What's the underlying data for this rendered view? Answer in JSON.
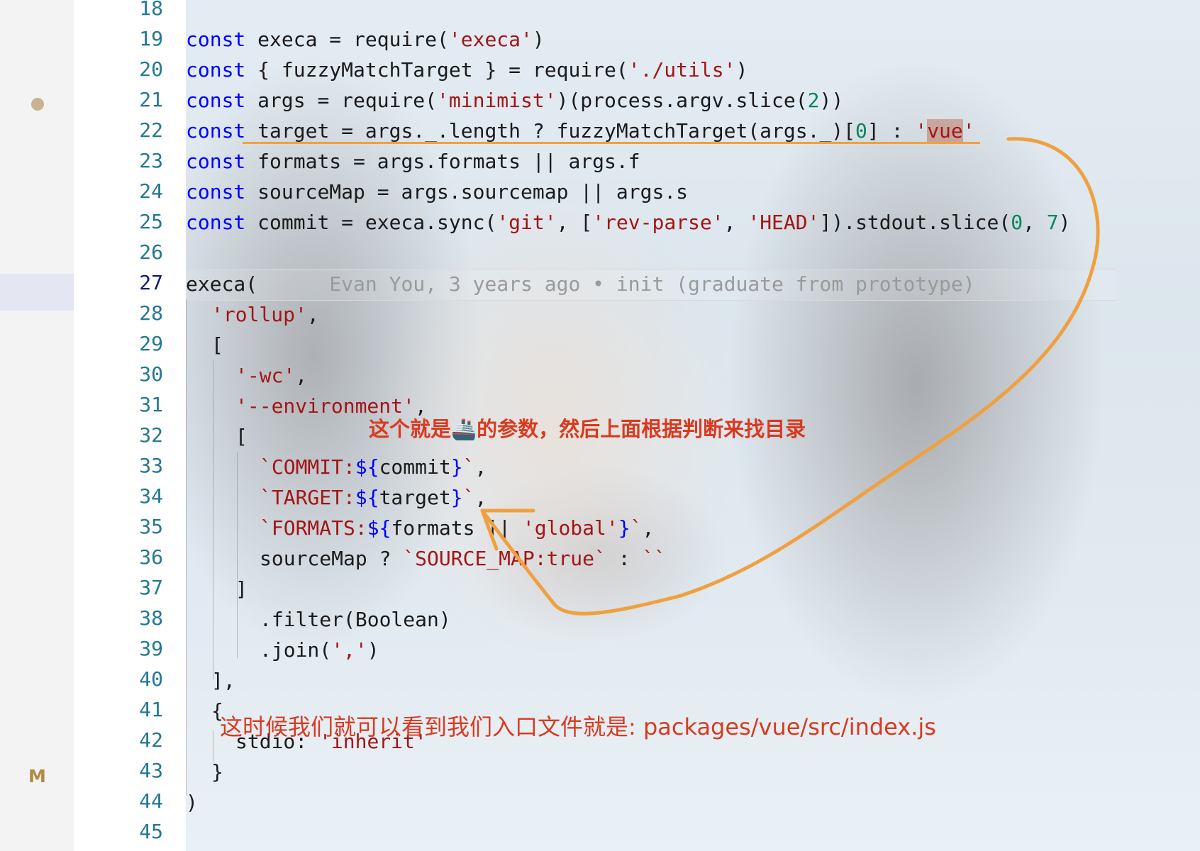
{
  "gutter": {
    "lines": [
      {
        "n": "18"
      },
      {
        "n": "19"
      },
      {
        "n": "20"
      },
      {
        "n": "21"
      },
      {
        "n": "22"
      },
      {
        "n": "23"
      },
      {
        "n": "24"
      },
      {
        "n": "25"
      },
      {
        "n": "26"
      },
      {
        "n": "27"
      },
      {
        "n": "28"
      },
      {
        "n": "29"
      },
      {
        "n": "30"
      },
      {
        "n": "31"
      },
      {
        "n": "32"
      },
      {
        "n": "33"
      },
      {
        "n": "34"
      },
      {
        "n": "35"
      },
      {
        "n": "36"
      },
      {
        "n": "37"
      },
      {
        "n": "38"
      },
      {
        "n": "39"
      },
      {
        "n": "40"
      },
      {
        "n": "41"
      },
      {
        "n": "42"
      },
      {
        "n": "43"
      },
      {
        "n": "44"
      },
      {
        "n": "45"
      }
    ],
    "active_line": "27",
    "git_modified_label": "M"
  },
  "code": {
    "l19": {
      "kw": "const",
      "a": " execa = require(",
      "s": "'execa'",
      "b": ")"
    },
    "l20": {
      "kw": "const",
      "a": " { fuzzyMatchTarget } = require(",
      "s": "'./utils'",
      "b": ")"
    },
    "l21": {
      "kw": "const",
      "a": " args = require(",
      "s": "'minimist'",
      "b": ")(process.argv.slice(",
      "n": "2",
      "c": "))"
    },
    "l22": {
      "kw": "const",
      "a": " target = args._.length ? fuzzyMatchTarget(args._)[",
      "n": "0",
      "b": "] : ",
      "s1": "'",
      "s2": "vue",
      "s3": "'"
    },
    "l23": {
      "kw": "const",
      "a": " formats = args.formats || args.f"
    },
    "l24": {
      "kw": "const",
      "a": " sourceMap = args.sourcemap || args.s"
    },
    "l25": {
      "kw": "const",
      "a": " commit = execa.sync(",
      "s1": "'git'",
      "b": ", [",
      "s2": "'rev-parse'",
      "c": ", ",
      "s3": "'HEAD'",
      "d": "]).stdout.slice(",
      "n1": "0",
      "e": ", ",
      "n2": "7",
      "f": ")"
    },
    "l27": {
      "a": "execa(",
      "blame": "Evan You, 3 years ago • init (graduate from prototype)"
    },
    "l28": {
      "s": "'rollup'",
      "b": ","
    },
    "l29": {
      "a": "["
    },
    "l30": {
      "s": "'-wc'",
      "b": ","
    },
    "l31": {
      "s": "'--environment'",
      "b": ","
    },
    "l32": {
      "a": "["
    },
    "l33": {
      "s1": "`COMMIT:",
      "p1": "${",
      "v": "commit",
      "p2": "}",
      "s2": "`",
      "b": ","
    },
    "l34": {
      "s1": "`TARGET:",
      "p1": "${",
      "v": "target",
      "p2": "}",
      "s2": "`",
      "b": ","
    },
    "l35": {
      "s1": "`FORMATS:",
      "p1": "${",
      "v": "formats || ",
      "s3": "'global'",
      "p2": "}",
      "s2": "`",
      "b": ","
    },
    "l36": {
      "a": "sourceMap ? ",
      "s1": "`SOURCE_MAP:true`",
      "b": " : ",
      "s2": "``"
    },
    "l37": {
      "a": "]"
    },
    "l38": {
      "a": ".filter(Boolean)"
    },
    "l39": {
      "a": ".join(",
      "s": "','",
      "b": ")"
    },
    "l40": {
      "a": "],"
    },
    "l41": {
      "a": "{"
    },
    "l42": {
      "a": "stdio: ",
      "s": "'inherit'"
    },
    "l43": {
      "a": "}"
    },
    "l44": {
      "a": ")"
    }
  },
  "annotations": {
    "note_1": "这个就是🚢的参数，然后上面根据判断来找目录",
    "note_2": "这时候我们就可以看到我们入口文件就是: packages/vue/src/index.js"
  },
  "colors": {
    "annotation_text": "#d93a1f",
    "annotation_stroke": "#f0a040",
    "keyword": "#0000ff",
    "string": "#a31515",
    "number": "#098658",
    "line_number": "#237893"
  }
}
